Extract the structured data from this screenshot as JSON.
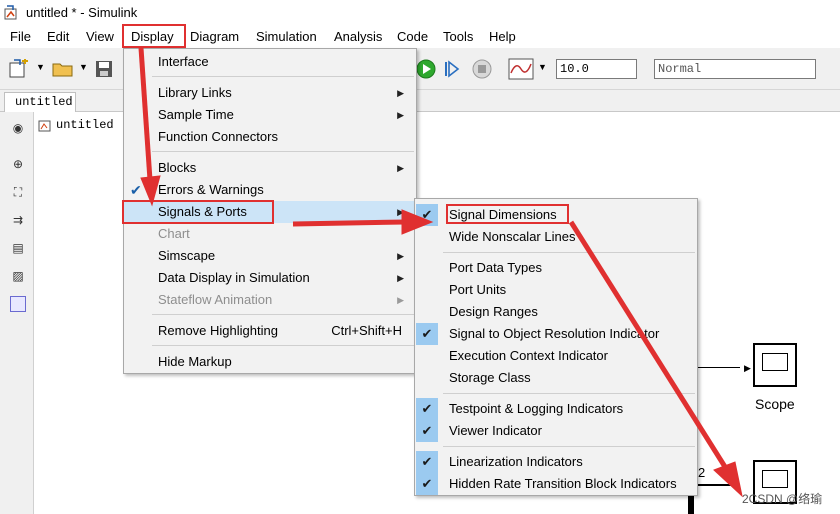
{
  "window": {
    "title": "untitled * - Simulink"
  },
  "menubar": {
    "items": [
      "File",
      "Edit",
      "View",
      "Display",
      "Diagram",
      "Simulation",
      "Analysis",
      "Code",
      "Tools",
      "Help"
    ]
  },
  "toolbar": {
    "stop_time": "10.0",
    "sim_mode": "Normal"
  },
  "tab": {
    "label": "untitled"
  },
  "breadcrumb": {
    "label": "untitled"
  },
  "display_menu": {
    "items": [
      {
        "label": "Interface",
        "submenu": false
      },
      {
        "label": "Library Links",
        "submenu": true
      },
      {
        "label": "Sample Time",
        "submenu": true
      },
      {
        "label": "Function Connectors",
        "submenu": false
      },
      {
        "label": "Blocks",
        "submenu": true
      },
      {
        "label": "Errors & Warnings",
        "checked": true
      },
      {
        "label": "Signals & Ports",
        "submenu": true,
        "active": true
      },
      {
        "label": "Chart",
        "disabled": true
      },
      {
        "label": "Simscape",
        "submenu": true
      },
      {
        "label": "Data Display in Simulation",
        "submenu": true
      },
      {
        "label": "Stateflow Animation",
        "submenu": true,
        "disabled": true
      },
      {
        "label": "Remove Highlighting",
        "shortcut": "Ctrl+Shift+H"
      },
      {
        "label": "Hide Markup"
      }
    ]
  },
  "signals_menu": {
    "items": [
      {
        "label": "Signal Dimensions",
        "checked": true
      },
      {
        "label": "Wide Nonscalar Lines"
      },
      {
        "label": "Port Data Types"
      },
      {
        "label": "Port Units"
      },
      {
        "label": "Design Ranges"
      },
      {
        "label": "Signal to Object Resolution Indicator",
        "checked": true
      },
      {
        "label": "Execution Context Indicator"
      },
      {
        "label": "Storage Class"
      },
      {
        "label": "Testpoint & Logging Indicators",
        "checked": true
      },
      {
        "label": "Viewer Indicator",
        "checked": true
      },
      {
        "label": "Linearization Indicators",
        "checked": true
      },
      {
        "label": "Hidden Rate Transition Block Indicators",
        "checked": true
      }
    ]
  },
  "canvas": {
    "scope_label": "Scope",
    "signal_dim_label": "2",
    "watermark": "2CSDN @络瑜"
  },
  "colors": {
    "annotation": "#e03030",
    "menu_active": "#cce4f7",
    "check_bg": "#9bcaf0"
  }
}
